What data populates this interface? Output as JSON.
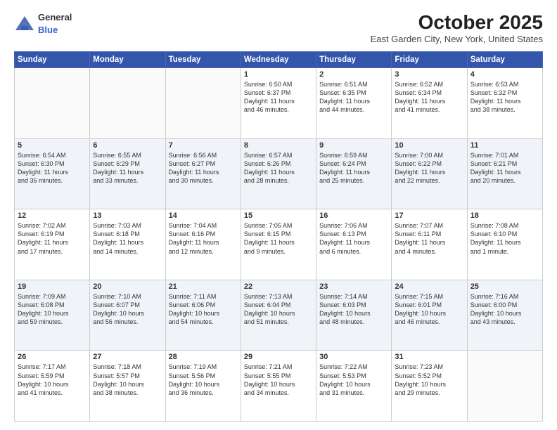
{
  "header": {
    "logo_general": "General",
    "logo_blue": "Blue",
    "title": "October 2025",
    "location": "East Garden City, New York, United States"
  },
  "days_of_week": [
    "Sunday",
    "Monday",
    "Tuesday",
    "Wednesday",
    "Thursday",
    "Friday",
    "Saturday"
  ],
  "weeks": [
    [
      {
        "day": "",
        "info": ""
      },
      {
        "day": "",
        "info": ""
      },
      {
        "day": "",
        "info": ""
      },
      {
        "day": "1",
        "info": "Sunrise: 6:50 AM\nSunset: 6:37 PM\nDaylight: 11 hours\nand 46 minutes."
      },
      {
        "day": "2",
        "info": "Sunrise: 6:51 AM\nSunset: 6:35 PM\nDaylight: 11 hours\nand 44 minutes."
      },
      {
        "day": "3",
        "info": "Sunrise: 6:52 AM\nSunset: 6:34 PM\nDaylight: 11 hours\nand 41 minutes."
      },
      {
        "day": "4",
        "info": "Sunrise: 6:53 AM\nSunset: 6:32 PM\nDaylight: 11 hours\nand 38 minutes."
      }
    ],
    [
      {
        "day": "5",
        "info": "Sunrise: 6:54 AM\nSunset: 6:30 PM\nDaylight: 11 hours\nand 36 minutes."
      },
      {
        "day": "6",
        "info": "Sunrise: 6:55 AM\nSunset: 6:29 PM\nDaylight: 11 hours\nand 33 minutes."
      },
      {
        "day": "7",
        "info": "Sunrise: 6:56 AM\nSunset: 6:27 PM\nDaylight: 11 hours\nand 30 minutes."
      },
      {
        "day": "8",
        "info": "Sunrise: 6:57 AM\nSunset: 6:26 PM\nDaylight: 11 hours\nand 28 minutes."
      },
      {
        "day": "9",
        "info": "Sunrise: 6:59 AM\nSunset: 6:24 PM\nDaylight: 11 hours\nand 25 minutes."
      },
      {
        "day": "10",
        "info": "Sunrise: 7:00 AM\nSunset: 6:22 PM\nDaylight: 11 hours\nand 22 minutes."
      },
      {
        "day": "11",
        "info": "Sunrise: 7:01 AM\nSunset: 6:21 PM\nDaylight: 11 hours\nand 20 minutes."
      }
    ],
    [
      {
        "day": "12",
        "info": "Sunrise: 7:02 AM\nSunset: 6:19 PM\nDaylight: 11 hours\nand 17 minutes."
      },
      {
        "day": "13",
        "info": "Sunrise: 7:03 AM\nSunset: 6:18 PM\nDaylight: 11 hours\nand 14 minutes."
      },
      {
        "day": "14",
        "info": "Sunrise: 7:04 AM\nSunset: 6:16 PM\nDaylight: 11 hours\nand 12 minutes."
      },
      {
        "day": "15",
        "info": "Sunrise: 7:05 AM\nSunset: 6:15 PM\nDaylight: 11 hours\nand 9 minutes."
      },
      {
        "day": "16",
        "info": "Sunrise: 7:06 AM\nSunset: 6:13 PM\nDaylight: 11 hours\nand 6 minutes."
      },
      {
        "day": "17",
        "info": "Sunrise: 7:07 AM\nSunset: 6:11 PM\nDaylight: 11 hours\nand 4 minutes."
      },
      {
        "day": "18",
        "info": "Sunrise: 7:08 AM\nSunset: 6:10 PM\nDaylight: 11 hours\nand 1 minute."
      }
    ],
    [
      {
        "day": "19",
        "info": "Sunrise: 7:09 AM\nSunset: 6:08 PM\nDaylight: 10 hours\nand 59 minutes."
      },
      {
        "day": "20",
        "info": "Sunrise: 7:10 AM\nSunset: 6:07 PM\nDaylight: 10 hours\nand 56 minutes."
      },
      {
        "day": "21",
        "info": "Sunrise: 7:11 AM\nSunset: 6:06 PM\nDaylight: 10 hours\nand 54 minutes."
      },
      {
        "day": "22",
        "info": "Sunrise: 7:13 AM\nSunset: 6:04 PM\nDaylight: 10 hours\nand 51 minutes."
      },
      {
        "day": "23",
        "info": "Sunrise: 7:14 AM\nSunset: 6:03 PM\nDaylight: 10 hours\nand 48 minutes."
      },
      {
        "day": "24",
        "info": "Sunrise: 7:15 AM\nSunset: 6:01 PM\nDaylight: 10 hours\nand 46 minutes."
      },
      {
        "day": "25",
        "info": "Sunrise: 7:16 AM\nSunset: 6:00 PM\nDaylight: 10 hours\nand 43 minutes."
      }
    ],
    [
      {
        "day": "26",
        "info": "Sunrise: 7:17 AM\nSunset: 5:59 PM\nDaylight: 10 hours\nand 41 minutes."
      },
      {
        "day": "27",
        "info": "Sunrise: 7:18 AM\nSunset: 5:57 PM\nDaylight: 10 hours\nand 38 minutes."
      },
      {
        "day": "28",
        "info": "Sunrise: 7:19 AM\nSunset: 5:56 PM\nDaylight: 10 hours\nand 36 minutes."
      },
      {
        "day": "29",
        "info": "Sunrise: 7:21 AM\nSunset: 5:55 PM\nDaylight: 10 hours\nand 34 minutes."
      },
      {
        "day": "30",
        "info": "Sunrise: 7:22 AM\nSunset: 5:53 PM\nDaylight: 10 hours\nand 31 minutes."
      },
      {
        "day": "31",
        "info": "Sunrise: 7:23 AM\nSunset: 5:52 PM\nDaylight: 10 hours\nand 29 minutes."
      },
      {
        "day": "",
        "info": ""
      }
    ]
  ]
}
